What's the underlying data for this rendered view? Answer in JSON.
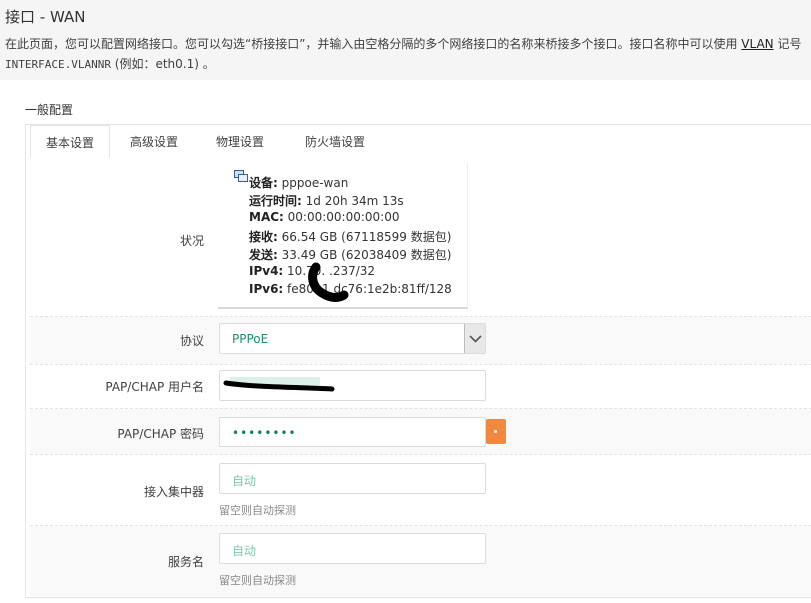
{
  "header": {
    "title": "接口 - WAN",
    "description_line1": "在此页面，您可以配置网络接口。您可以勾选“桥接接口”，并输入由空格分隔的多个网络接口的名称来桥接多个接口。接口名称中可以使用",
    "vlan_link": "VLAN",
    "description_line1_tail": " 记号",
    "description_code": "INTERFACE.VLANNR",
    "description_line2_tail": " (例如：eth0.1) 。"
  },
  "section": {
    "title": "一般配置"
  },
  "tabs": [
    {
      "label": "基本设置",
      "active": true
    },
    {
      "label": "高级设置",
      "active": false
    },
    {
      "label": "物理设置",
      "active": false
    },
    {
      "label": "防火墙设置",
      "active": false
    }
  ],
  "status": {
    "label": "状况",
    "device_key": "设备:",
    "device_val": " pppoe-wan",
    "uptime_key": "运行时间:",
    "uptime_val": " 1d 20h 34m 13s",
    "mac_key": "MAC:",
    "mac_val": " 00:00:00:00:00:00",
    "rx_key": "接收:",
    "rx_val": " 66.54 GB (67118599 数据包)",
    "tx_key": "发送:",
    "tx_val": " 33.49 GB (62038409 数据包)",
    "ipv4_key": "IPv4:",
    "ipv4_val": " 10.70.   .237/32",
    "ipv6_key": "IPv6:",
    "ipv6_val": " fe80::1     dc76:1e2b:81ff/128"
  },
  "protocol": {
    "label": "协议",
    "value": "PPPoE"
  },
  "username": {
    "label": "PAP/CHAP 用户名",
    "value": ""
  },
  "password": {
    "label": "PAP/CHAP 密码",
    "value": "••••••••"
  },
  "ac": {
    "label": "接入集中器",
    "placeholder": "自动",
    "hint": "留空则自动探测"
  },
  "service": {
    "label": "服务名",
    "placeholder": "自动",
    "hint": "留空则自动探测"
  },
  "colors": {
    "accent_text": "#1a8f6f",
    "reveal_button": "#f0883e"
  }
}
